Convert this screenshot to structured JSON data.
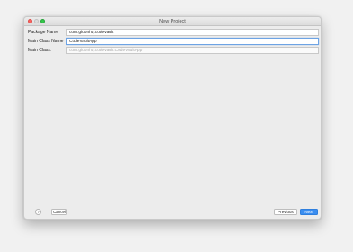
{
  "window": {
    "title": "New Project"
  },
  "form": {
    "package_name": {
      "label": "Package Name",
      "value": "com.gluonhq.codevault"
    },
    "main_class_name": {
      "label": "Main Class Name",
      "value": "CodeVaultApp"
    },
    "main_class": {
      "label": "Main Class:",
      "value": "com.gluonhq.codevault.CodeVaultApp"
    }
  },
  "footer": {
    "help_label": "?",
    "cancel_label": "Cancel",
    "previous_label": "Previous",
    "next_label": "Next"
  },
  "colors": {
    "accent": "#3b8ef0",
    "close": "#fc615d",
    "zoom": "#34c84a"
  }
}
